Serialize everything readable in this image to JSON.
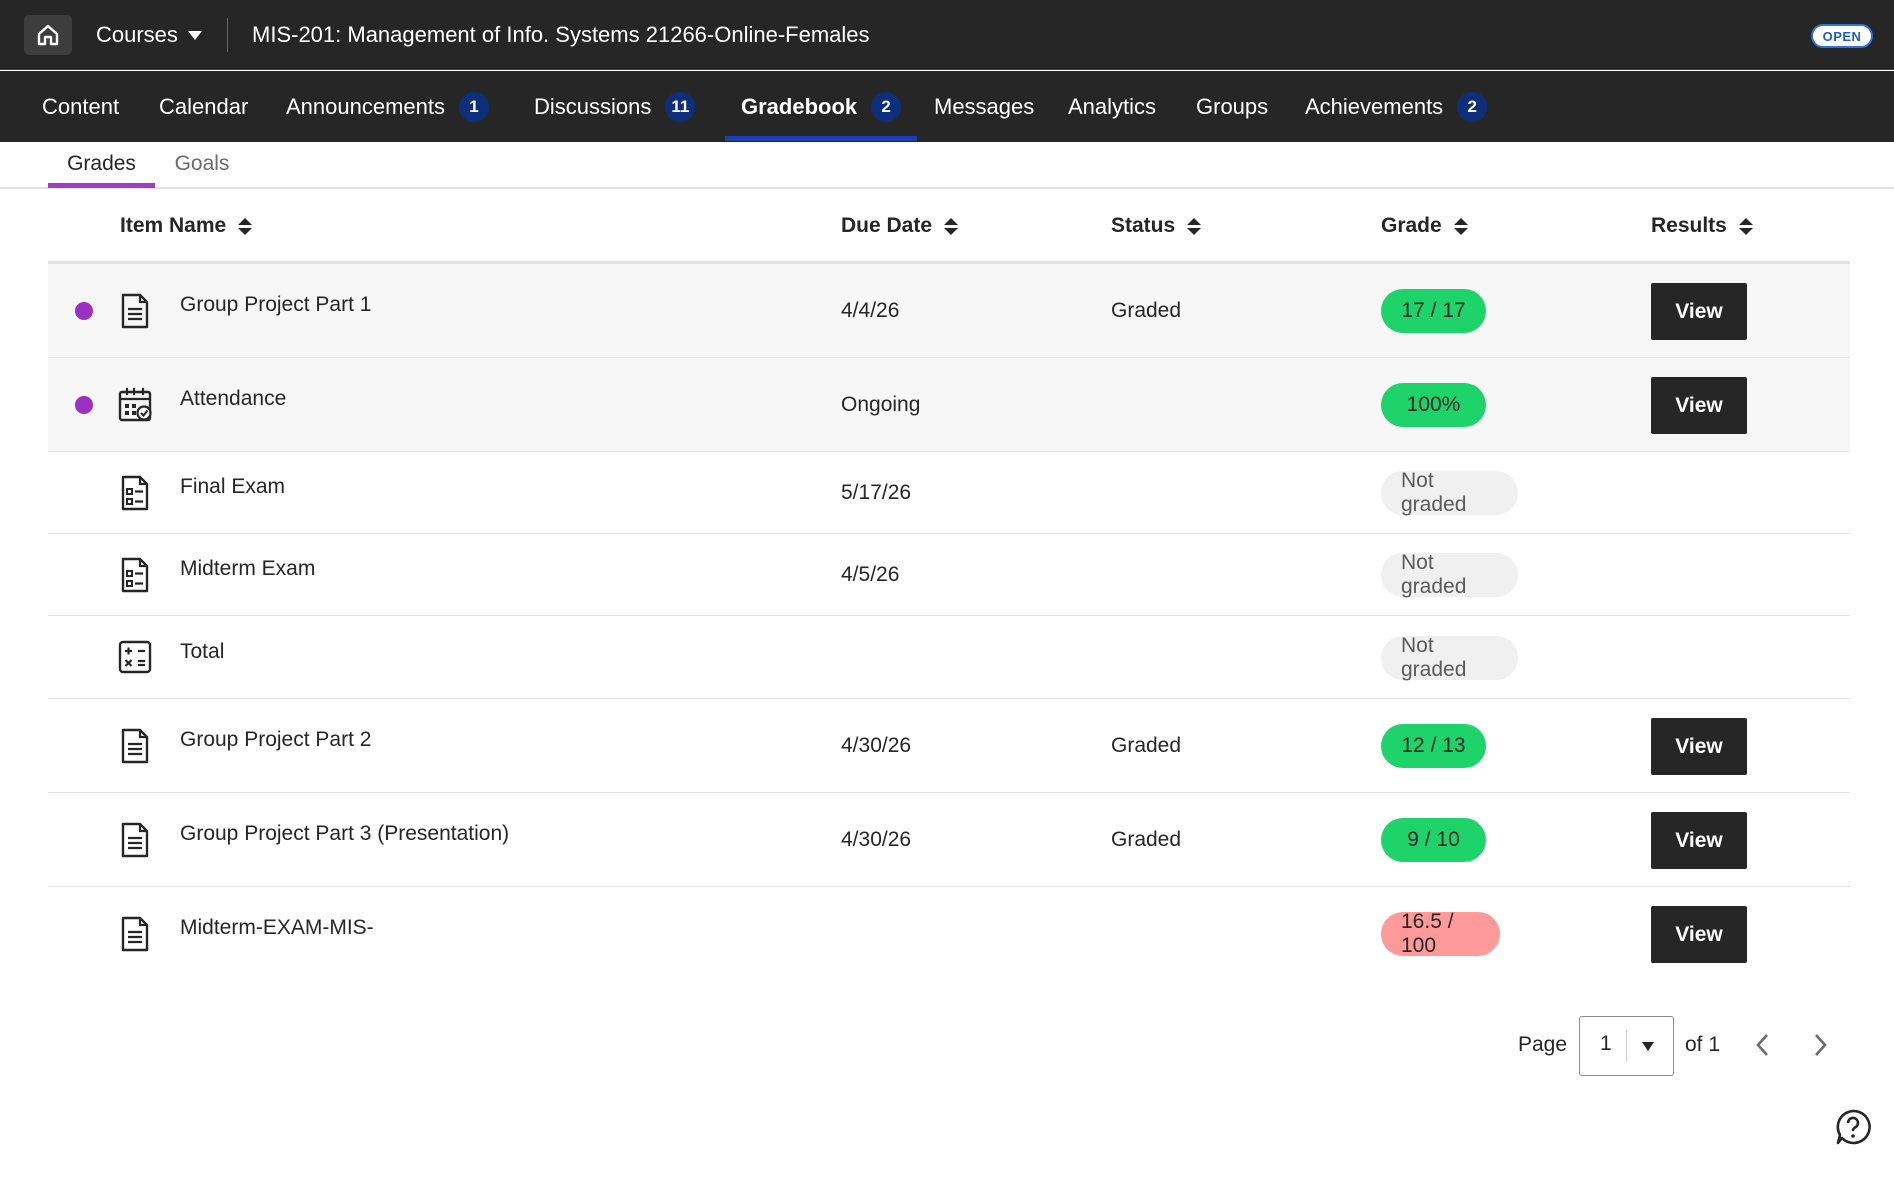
{
  "header": {
    "courses_label": "Courses",
    "course_title": "MIS-201: Management of Info. Systems 21266-Online-Females",
    "open_badge": "OPEN"
  },
  "nav": {
    "items": [
      {
        "label": "Content",
        "count": ""
      },
      {
        "label": "Calendar",
        "count": ""
      },
      {
        "label": "Announcements",
        "count": "1"
      },
      {
        "label": "Discussions",
        "count": "11"
      },
      {
        "label": "Gradebook",
        "count": "2"
      },
      {
        "label": "Messages",
        "count": ""
      },
      {
        "label": "Analytics",
        "count": ""
      },
      {
        "label": "Groups",
        "count": ""
      },
      {
        "label": "Achievements",
        "count": "2"
      }
    ],
    "active": "Gradebook"
  },
  "subtabs": {
    "grades": "Grades",
    "goals": "Goals",
    "active": "Grades"
  },
  "table": {
    "columns": {
      "item_name": "Item Name",
      "due_date": "Due Date",
      "status": "Status",
      "grade": "Grade",
      "results": "Results"
    },
    "rows": [
      {
        "name": "Group Project Part 1",
        "icon": "document-icon",
        "due": "4/4/26",
        "status": "Graded",
        "grade": "17 / 17",
        "grade_style": "green",
        "result": "View",
        "new": true
      },
      {
        "name": "Attendance",
        "icon": "attendance-calendar-icon",
        "due": "Ongoing",
        "status": "",
        "grade": "100%",
        "grade_style": "green",
        "result": "View",
        "new": true
      },
      {
        "name": "Final Exam",
        "icon": "test-icon",
        "due": "5/17/26",
        "status": "",
        "grade": "Not graded",
        "grade_style": "grey",
        "result": "",
        "new": false
      },
      {
        "name": "Midterm Exam",
        "icon": "test-icon",
        "due": "4/5/26",
        "status": "",
        "grade": "Not graded",
        "grade_style": "grey",
        "result": "",
        "new": false
      },
      {
        "name": "Total",
        "icon": "calculator-icon",
        "due": "",
        "status": "",
        "grade": "Not graded",
        "grade_style": "grey",
        "result": "",
        "new": false
      },
      {
        "name": "Group Project Part 2",
        "icon": "document-icon",
        "due": "4/30/26",
        "status": "Graded",
        "grade": "12 / 13",
        "grade_style": "green",
        "result": "View",
        "new": false
      },
      {
        "name": "Group Project Part 3 (Presentation)",
        "icon": "document-icon",
        "due": "4/30/26",
        "status": "Graded",
        "grade": "9 / 10",
        "grade_style": "green",
        "result": "View",
        "new": false
      },
      {
        "name": "Midterm-EXAM-MIS-",
        "icon": "document-icon",
        "due": "",
        "status": "",
        "grade": "16.5 / 100",
        "grade_style": "red",
        "result": "View",
        "new": false
      }
    ]
  },
  "pagination": {
    "page_label": "Page",
    "current": "1",
    "of_label": "of 1"
  },
  "colors": {
    "bar_bg": "#262626",
    "nav_count_bg": "#0d2f7a",
    "active_underline": "#1d3fae",
    "tab_underline": "#9a3fbf",
    "new_dot": "#9b30c4",
    "grade_green": "#1fd36b",
    "grade_red": "#ff9a9a",
    "grade_grey": "#f0f0f0"
  }
}
